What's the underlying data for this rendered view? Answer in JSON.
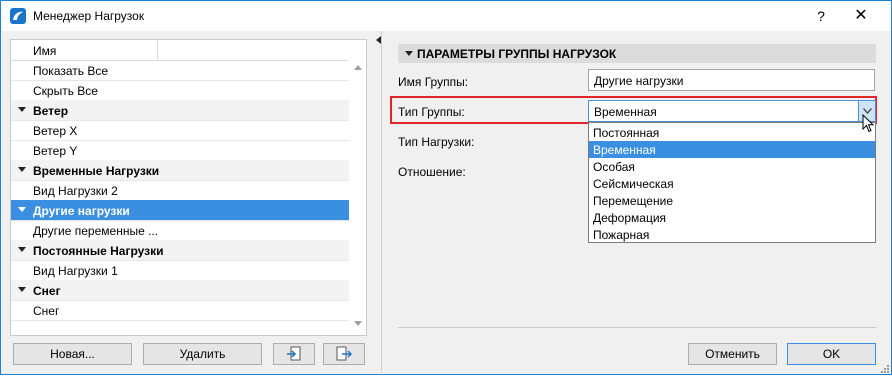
{
  "window": {
    "title": "Менеджер Нагрузок",
    "help_label": "?",
    "close_label": "✕"
  },
  "list": {
    "header": "Имя",
    "rows": [
      {
        "label": "Показать Все",
        "type": "item"
      },
      {
        "label": "Скрыть Все",
        "type": "item"
      },
      {
        "label": "Ветер",
        "type": "group"
      },
      {
        "label": "Ветер X",
        "type": "item"
      },
      {
        "label": "Ветер Y",
        "type": "item"
      },
      {
        "label": "Временные Нагрузки",
        "type": "group"
      },
      {
        "label": "Вид Нагрузки 2",
        "type": "item"
      },
      {
        "label": "Другие нагрузки",
        "type": "group",
        "selected": true
      },
      {
        "label": "Другие переменные ...",
        "type": "item"
      },
      {
        "label": "Постоянные Нагрузки",
        "type": "group"
      },
      {
        "label": "Вид Нагрузки 1",
        "type": "item"
      },
      {
        "label": "Снег",
        "type": "group"
      },
      {
        "label": "Снег",
        "type": "item"
      }
    ]
  },
  "buttons": {
    "new": "Новая...",
    "delete": "Удалить",
    "import_icon": "import-icon",
    "export_icon": "export-icon",
    "cancel": "Отменить",
    "ok": "OK"
  },
  "params": {
    "section_title": "ПАРАМЕТРЫ ГРУППЫ НАГРУЗОК",
    "group_name_label": "Имя Группы:",
    "group_name_value": "Другие нагрузки",
    "group_type_label": "Тип Группы:",
    "group_type_value": "Временная",
    "load_type_label": "Тип Нагрузки:",
    "ratio_label": "Отношение:"
  },
  "dropdown": {
    "options": [
      "Постоянная",
      "Временная",
      "Особая",
      "Сейсмическая",
      "Перемещение",
      "Деформация",
      "Пожарная"
    ],
    "active": "Временная"
  },
  "colors": {
    "accent": "#3b8fe0",
    "highlight": "#e0262b",
    "window_border": "#1e7fd0"
  }
}
